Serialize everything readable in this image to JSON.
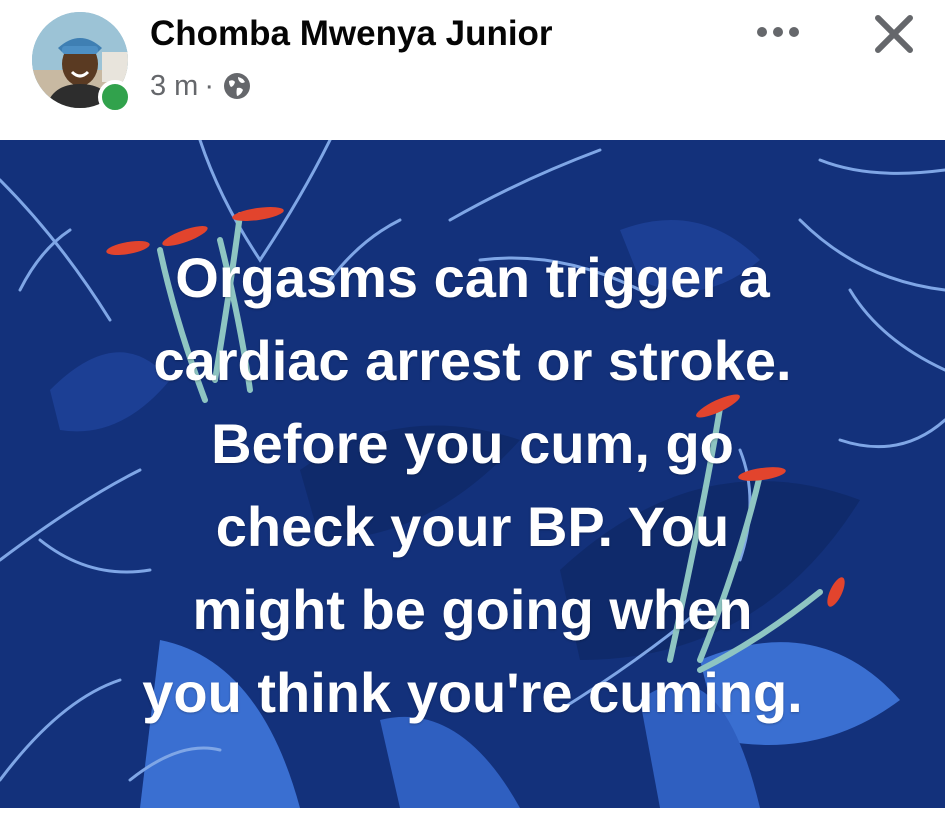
{
  "post": {
    "author": {
      "name": "Chomba Mwenya Junior",
      "avatar_icon": "profile-photo",
      "online": true,
      "online_color": "#31a24c"
    },
    "meta": {
      "time": "3 m",
      "separator": "·",
      "audience_icon": "globe-icon"
    },
    "actions": {
      "more_icon": "more-options-icon",
      "close_icon": "close-icon"
    },
    "image": {
      "background_color": "#13317b",
      "text_lines": [
        "Orgasms can trigger a",
        "cardiac arrest or stroke.",
        "Before you cum, go",
        "check your BP. You",
        "might be going when",
        "you think you're cuming."
      ]
    }
  }
}
